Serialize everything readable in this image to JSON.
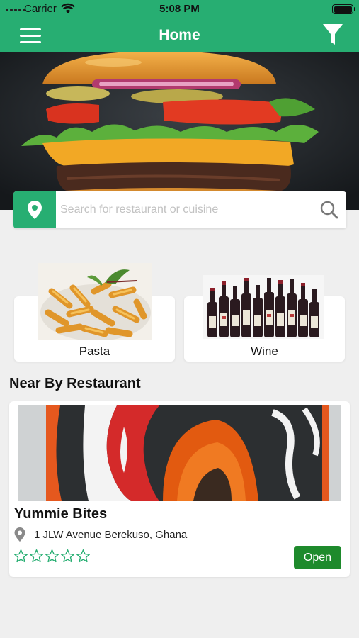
{
  "status_bar": {
    "carrier": "Carrier",
    "time": "5:08 PM"
  },
  "navbar": {
    "title": "Home",
    "menu_icon": "hamburger-menu-icon",
    "filter_icon": "filter-funnel-icon"
  },
  "hero": {
    "image": "burger-photo"
  },
  "search": {
    "placeholder": "Search for restaurant or cuisine",
    "value": "",
    "location_icon": "location-pin-icon",
    "search_icon": "search-icon"
  },
  "categories": [
    {
      "label": "Pasta",
      "image": "pasta-photo"
    },
    {
      "label": "Wine",
      "image": "wine-bottles-photo"
    }
  ],
  "nearby": {
    "title": "Near By Restaurant",
    "restaurants": [
      {
        "name": "Yummie Bites",
        "address": "1 JLW Avenue Berekuso, Ghana",
        "rating": 0,
        "max_rating": 5,
        "status": "Open",
        "status_color": "#1e8a2c"
      }
    ]
  },
  "colors": {
    "primary": "#27ae72",
    "open_badge": "#1e8a2c",
    "background": "#efefef"
  }
}
